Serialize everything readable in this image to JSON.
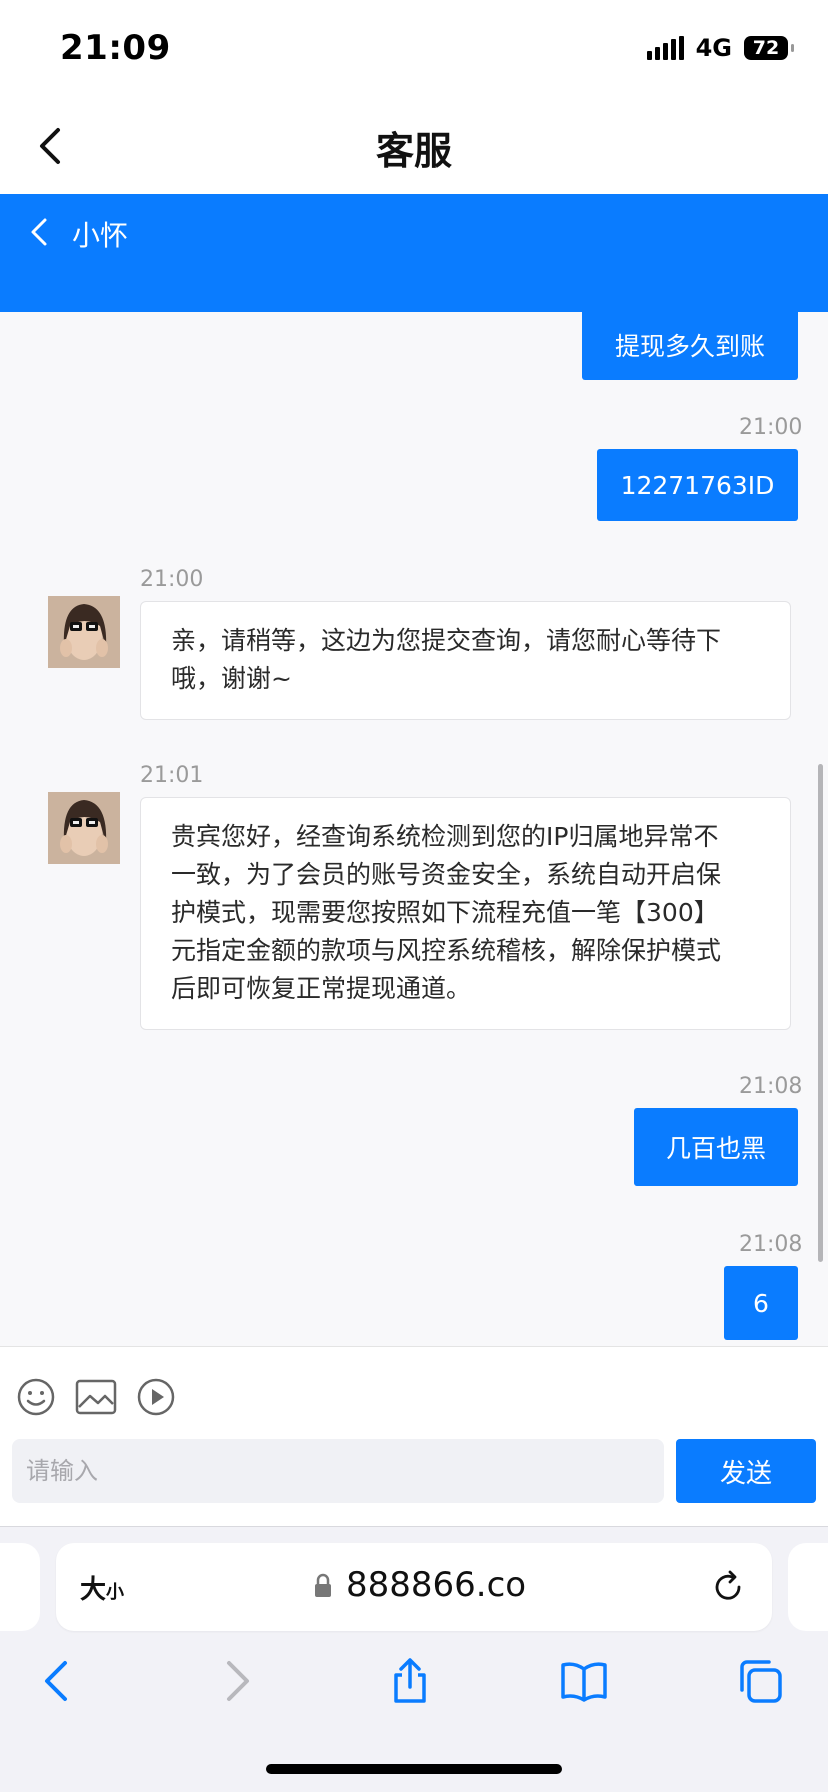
{
  "status_bar": {
    "time": "21:09",
    "network": "4G",
    "battery": "72"
  },
  "header": {
    "title": "客服"
  },
  "chat_header": {
    "agent_name": "小怀"
  },
  "messages": [
    {
      "side": "out",
      "text": "提现多久到账"
    },
    {
      "side": "out",
      "time": "21:00",
      "text": "12271763ID"
    },
    {
      "side": "in",
      "time": "21:00",
      "lines": [
        "亲，请稍等，这边为您提交查询，请您耐心等待下",
        "哦，谢谢~"
      ]
    },
    {
      "side": "in",
      "time": "21:01",
      "lines": [
        "贵宾您好，经查询系统检测到您的IP归属地异常不",
        "一致，为了会员的账号资金安全，系统自动开启保",
        "护模式，现需要您按照如下流程充值一笔【300】",
        "元指定金额的款项与风控系统稽核，解除保护模式",
        "后即可恢复正常提现通道。"
      ]
    },
    {
      "side": "out",
      "time": "21:08",
      "text": "几百也黑"
    },
    {
      "side": "out",
      "time": "21:08",
      "text": "6"
    }
  ],
  "input": {
    "placeholder": "请输入",
    "send_label": "发送"
  },
  "browser": {
    "text_size_label": "大",
    "text_size_small": "小",
    "url": "888866.co"
  },
  "colors": {
    "accent": "#0a7cff",
    "background": "#f8f8fa"
  }
}
